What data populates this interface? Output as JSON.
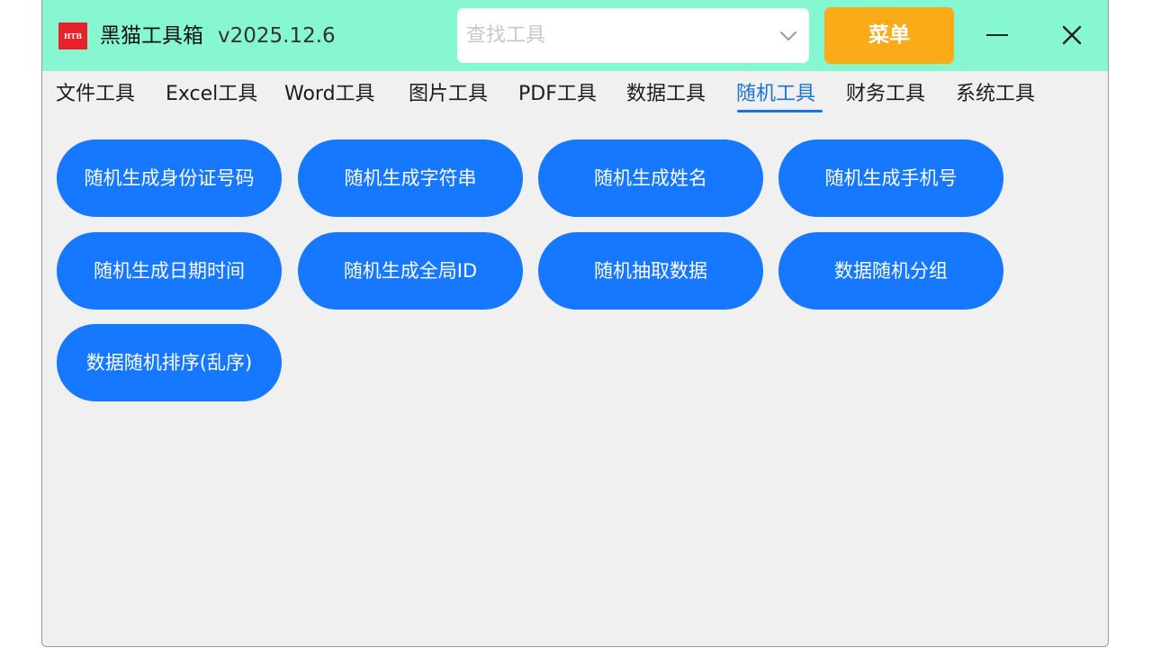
{
  "titlebar": {
    "logo_text": "HTB",
    "app_name": "黑猫工具箱",
    "version": "v2025.12.6",
    "search_placeholder": "查找工具",
    "menu_label": "菜单"
  },
  "tabs": [
    {
      "label": "文件工具"
    },
    {
      "label": "Excel工具"
    },
    {
      "label": "Word工具"
    },
    {
      "label": "图片工具"
    },
    {
      "label": "PDF工具"
    },
    {
      "label": "数据工具"
    },
    {
      "label": "随机工具",
      "active": true
    },
    {
      "label": "财务工具"
    },
    {
      "label": "系统工具"
    }
  ],
  "tools": [
    {
      "label": "随机生成身份证号码"
    },
    {
      "label": "随机生成字符串"
    },
    {
      "label": "随机生成姓名"
    },
    {
      "label": "随机生成手机号"
    },
    {
      "label": "随机生成日期时间"
    },
    {
      "label": "随机生成全局ID"
    },
    {
      "label": "随机抽取数据"
    },
    {
      "label": "数据随机分组"
    },
    {
      "label": "数据随机排序(乱序)"
    }
  ],
  "colors": {
    "titlebar_bg": "#86f7d0",
    "menu_button": "#fbab18",
    "tool_button": "#1677ff",
    "active_tab": "#1a73d9"
  }
}
